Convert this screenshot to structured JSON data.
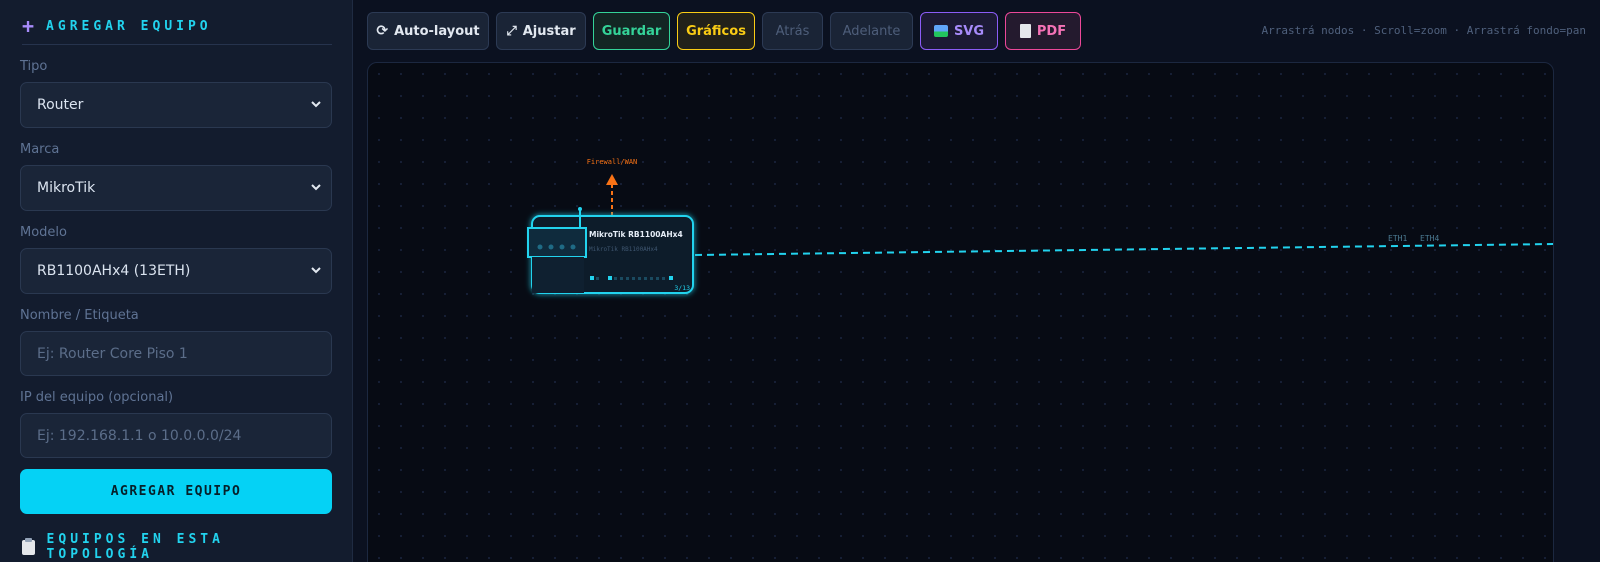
{
  "sidebar": {
    "add_section_title": "AGREGAR EQUIPO",
    "tipo": {
      "label": "Tipo",
      "value": "Router"
    },
    "marca": {
      "label": "Marca",
      "value": "MikroTik"
    },
    "modelo": {
      "label": "Modelo",
      "value": "RB1100AHx4 (13ETH)"
    },
    "nombre": {
      "label": "Nombre / Etiqueta",
      "placeholder": "Ej: Router Core Piso 1"
    },
    "ip": {
      "label": "IP del equipo (opcional)",
      "placeholder": "Ej: 192.168.1.1 o 10.0.0.0/24"
    },
    "add_button": "AGREGAR EQUIPO",
    "list_section_title": "EQUIPOS EN ESTA TOPOLOGÍA"
  },
  "toolbar": {
    "auto_layout": "Auto-layout",
    "ajustar": "Ajustar",
    "guardar": "Guardar",
    "graficos": "Gráficos",
    "atras": "Atrás",
    "adelante": "Adelante",
    "svg": "SVG",
    "pdf": "PDF",
    "hint": "Arrastrá nodos · Scroll=zoom · Arrastrá fondo=pan"
  },
  "canvas": {
    "node": {
      "title": "MikroTik RB1100AHx4",
      "subtitle": "MikroTik RB1100AHx4",
      "port_count": "3/13"
    },
    "uplink_label": "Firewall/WAN",
    "link_labels": [
      "ETH1",
      "ETH4"
    ],
    "colors": {
      "accent": "#22d3ee",
      "uplink": "#f97316"
    }
  }
}
